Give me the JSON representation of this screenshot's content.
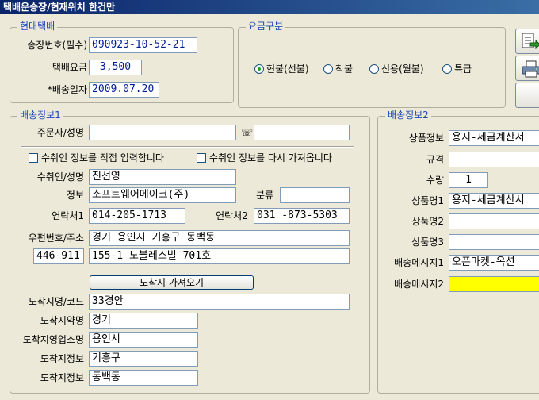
{
  "window": {
    "title": "택배운송장/현재위치 한건만"
  },
  "section_courier": {
    "legend": "현대택배",
    "invoice_label": "송장번호(필수)",
    "invoice_value": "090923-10-52-21",
    "fee_label": "택배요금",
    "fee_value": "3,500",
    "date_label": "*배송일자",
    "date_value": "2009.07.20"
  },
  "section_fee_type": {
    "legend": "요금구분",
    "options": [
      "현불(선불)",
      "착불",
      "신용(월불)",
      "특급"
    ],
    "selected": "현불(선불)"
  },
  "section_delivery1": {
    "legend": "배송정보1",
    "orderer_label": "주문자/성명",
    "orderer_value": "",
    "phone_icon": "☏",
    "phone_value": "",
    "check_direct": "수취인 정보를 직접 입력합니다",
    "check_reload": "수취인 정보를 다시 가져옵니다",
    "recipient_label": "수취인/성명",
    "recipient_value": "진선영",
    "info_label": "정보",
    "info_value": "소프트웨어메이크(주)",
    "category_label": "분류",
    "category_value": "",
    "contact1_label": "연락처1",
    "contact1_value": "014-205-1713",
    "contact2_label": "연락처2",
    "contact2_value": "031 -873-5303",
    "address_label": "우편번호/주소",
    "address1_value": "경기 용인시 기흥구 동백동",
    "postcode_value": "446-911",
    "address2_value": "155-1 노블레스빌 701호",
    "fetch_button": "도착지 가져오기",
    "dest_code_label": "도착지명/코드",
    "dest_code_value": "33경안",
    "dest_abbr_label": "도착지약명",
    "dest_abbr_value": "경기",
    "dest_office_label": "도착지영업소명",
    "dest_office_value": "용인시",
    "dest_info1_label": "도착지정보",
    "dest_info1_value": "기흥구",
    "dest_info2_label": "도착지정보",
    "dest_info2_value": "동백동"
  },
  "section_delivery2": {
    "legend": "배송정보2",
    "product_info_label": "상품정보",
    "product_info_value": "용지-세금계산서",
    "spec_label": "규격",
    "spec_value": "",
    "qty_label": "수량",
    "qty_value": "1",
    "product1_label": "상품명1",
    "product1_value": "용지-세금계산서",
    "product2_label": "상품명2",
    "product2_value": "",
    "product3_label": "상품명3",
    "product3_value": "",
    "msg1_label": "배송메시지1",
    "msg1_value": "오픈마켓-옥션",
    "msg2_label": "배송메시지2",
    "msg2_value": ""
  },
  "toolbar": {
    "icons": [
      "export-icon",
      "print-icon",
      "blank"
    ]
  }
}
